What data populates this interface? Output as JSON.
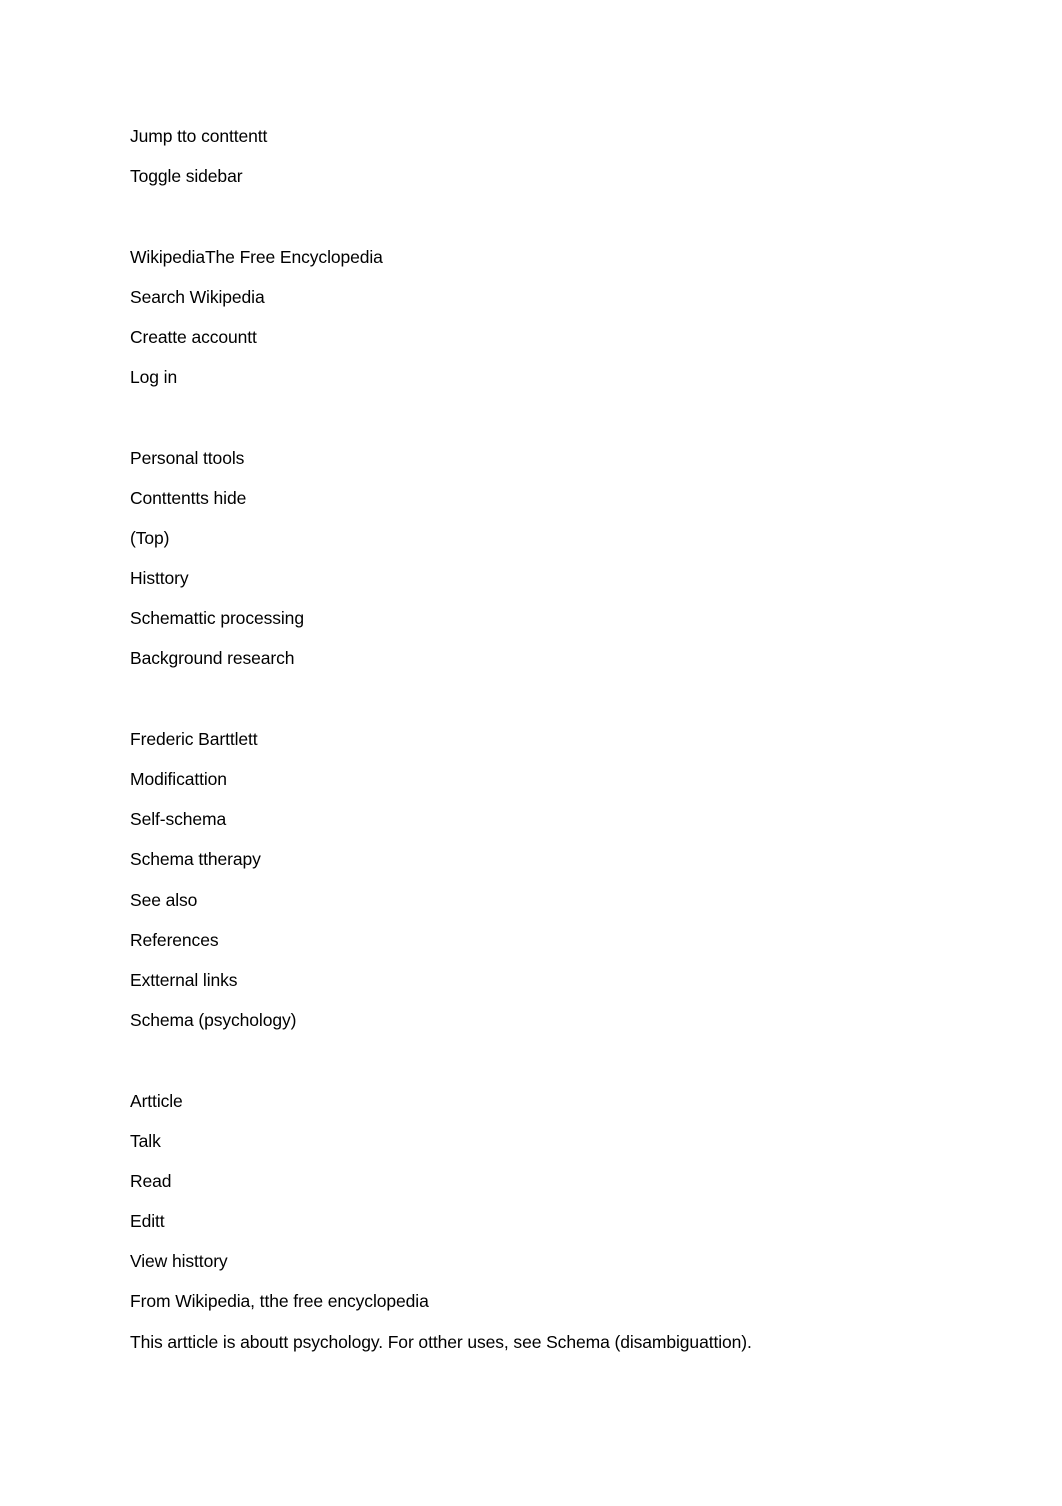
{
  "page": {
    "lines": [
      {
        "type": "link",
        "name": "skip-to-content-link",
        "text": "Jump tto conttentt"
      },
      {
        "type": "button",
        "name": "toggle-sidebar-button",
        "text": "Toggle sidebar"
      },
      {
        "type": "blank"
      },
      {
        "type": "link",
        "name": "wikipedia-logo-link",
        "text": "WikipediaThe Free Encyclopedia"
      },
      {
        "type": "input",
        "name": "search-wikipedia-field",
        "text": "Search Wikipedia"
      },
      {
        "type": "link",
        "name": "create-account-link",
        "text": "Creatte accountt"
      },
      {
        "type": "link",
        "name": "log-in-link",
        "text": "Log in"
      },
      {
        "type": "blank"
      },
      {
        "type": "button",
        "name": "personal-tools-button",
        "text": "Personal ttools"
      },
      {
        "type": "button",
        "name": "contents-hide-button",
        "text": "Conttentts hide"
      },
      {
        "type": "link",
        "name": "toc-item-top",
        "text": "(Top)"
      },
      {
        "type": "link",
        "name": "toc-item-history",
        "text": "Histtory"
      },
      {
        "type": "link",
        "name": "toc-item-schematic-processing",
        "text": "Schemattic processing"
      },
      {
        "type": "link",
        "name": "toc-item-background-research",
        "text": "Background research"
      },
      {
        "type": "blank"
      },
      {
        "type": "link",
        "name": "toc-item-frederic-bartlett",
        "text": "Frederic Barttlett"
      },
      {
        "type": "link",
        "name": "toc-item-modification",
        "text": "Modificattion"
      },
      {
        "type": "link",
        "name": "toc-item-self-schema",
        "text": "Self-schema"
      },
      {
        "type": "link",
        "name": "toc-item-schema-therapy",
        "text": "Schema ttherapy"
      },
      {
        "type": "link",
        "name": "toc-item-see-also",
        "text": "See also"
      },
      {
        "type": "link",
        "name": "toc-item-references",
        "text": "References"
      },
      {
        "type": "link",
        "name": "toc-item-external-links",
        "text": "Extternal links"
      },
      {
        "type": "heading",
        "name": "page-title",
        "text": "Schema (psychology)"
      },
      {
        "type": "blank"
      },
      {
        "type": "link",
        "name": "tab-article",
        "text": "Artticle"
      },
      {
        "type": "link",
        "name": "tab-talk",
        "text": "Talk"
      },
      {
        "type": "link",
        "name": "tab-read",
        "text": "Read"
      },
      {
        "type": "link",
        "name": "tab-edit",
        "text": "Editt"
      },
      {
        "type": "link",
        "name": "tab-view-history",
        "text": "View histtory"
      },
      {
        "type": "text",
        "name": "site-subtitle",
        "text": "From Wikipedia, tthe free encyclopedia"
      },
      {
        "type": "text",
        "name": "hatnote",
        "text": "This artticle is aboutt psychology. For otther uses, see Schema (disambiguattion)."
      }
    ]
  }
}
